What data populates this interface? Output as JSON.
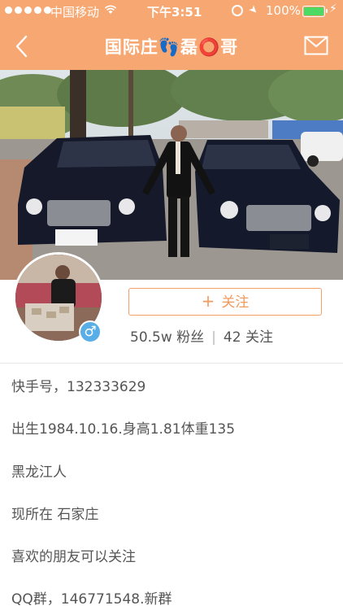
{
  "status_bar": {
    "carrier": "中国移动",
    "time": "下午3:51",
    "battery_percent": "100%",
    "battery_level": 1.0,
    "battery_color": "#4cd964"
  },
  "nav": {
    "title": "国际庄👣磊⭕哥",
    "back_icon": "chevron-left-icon",
    "message_icon": "envelope-icon"
  },
  "colors": {
    "brand": "#f7a872",
    "follow_accent": "#f29a5c",
    "gender_badge": "#5aaee8"
  },
  "profile": {
    "gender_symbol": "♂",
    "follow_plus": "+",
    "follow_label": "关注",
    "followers": "50.5w 粉丝",
    "separator": "|",
    "following": "42 关注"
  },
  "bio": [
    "快手号，132333629",
    "出生1984.10.16.身高1.81体重135",
    "黑龙江人",
    "现所在  石家庄",
    "喜欢的朋友可以关注",
    "QQ群，146771548.新群"
  ]
}
